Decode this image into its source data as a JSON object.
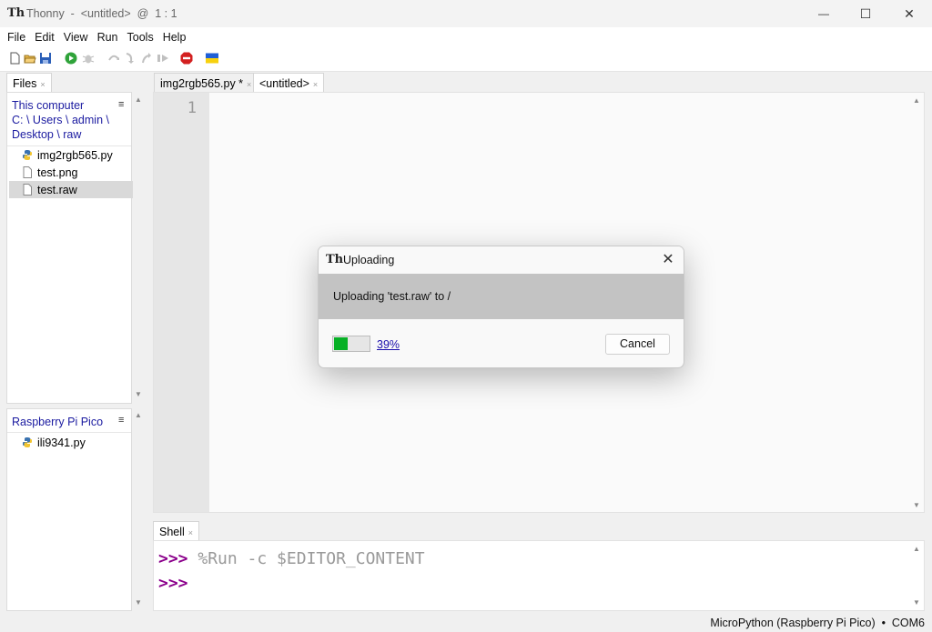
{
  "window": {
    "title": "Thonny  -  <untitled>  @  1 : 1",
    "minimize_glyph": "—",
    "maximize_glyph": "☐",
    "close_glyph": "✕"
  },
  "menu": [
    "File",
    "Edit",
    "View",
    "Run",
    "Tools",
    "Help"
  ],
  "toolbar_icons": [
    "new-file-icon",
    "open-file-icon",
    "save-icon",
    "run-icon",
    "debug-icon",
    "step-over-icon",
    "step-into-icon",
    "step-out-icon",
    "resume-icon",
    "stop-icon",
    "ukraine-flag-icon"
  ],
  "files_panel": {
    "tab_label": "Files",
    "tab_close": "×",
    "menu_glyph": "≡",
    "computer_header": "This computer",
    "path_line1": "C: \\ Users \\ admin \\",
    "path_line2": "Desktop \\ raw",
    "local_files": [
      {
        "name": "img2rgb565.py",
        "icon": "python-file-icon"
      },
      {
        "name": "test.png",
        "icon": "file-icon"
      },
      {
        "name": "test.raw",
        "icon": "file-icon",
        "selected": true
      }
    ],
    "device_header": "Raspberry Pi Pico",
    "device_files": [
      {
        "name": "ili9341.py",
        "icon": "python-file-icon"
      }
    ]
  },
  "editor": {
    "tabs": [
      {
        "label": "img2rgb565.py *",
        "close": "×"
      },
      {
        "label": "<untitled>",
        "close": "×",
        "active": true
      }
    ],
    "line_numbers": [
      "1"
    ]
  },
  "shell": {
    "tab_label": "Shell",
    "tab_close": "×",
    "prompt": ">>> ",
    "command": "%Run -c $EDITOR_CONTENT"
  },
  "status": {
    "interpreter": "MicroPython (Raspberry Pi Pico)  •  COM6"
  },
  "dialog": {
    "title": "Uploading",
    "close_glyph": "✕",
    "message": "Uploading 'test.raw' to /",
    "progress_fraction": 0.39,
    "progress_label": "39%",
    "cancel_label": "Cancel"
  },
  "colors": {
    "progress_green": "#06b025",
    "path_blue": "#1a1aa0",
    "prompt_purple": "#8b008b",
    "link_blue": "#1a0dab"
  },
  "scroll_arrow_up": "▲",
  "scroll_arrow_down": "▼",
  "app_icon_glyph": "Th"
}
